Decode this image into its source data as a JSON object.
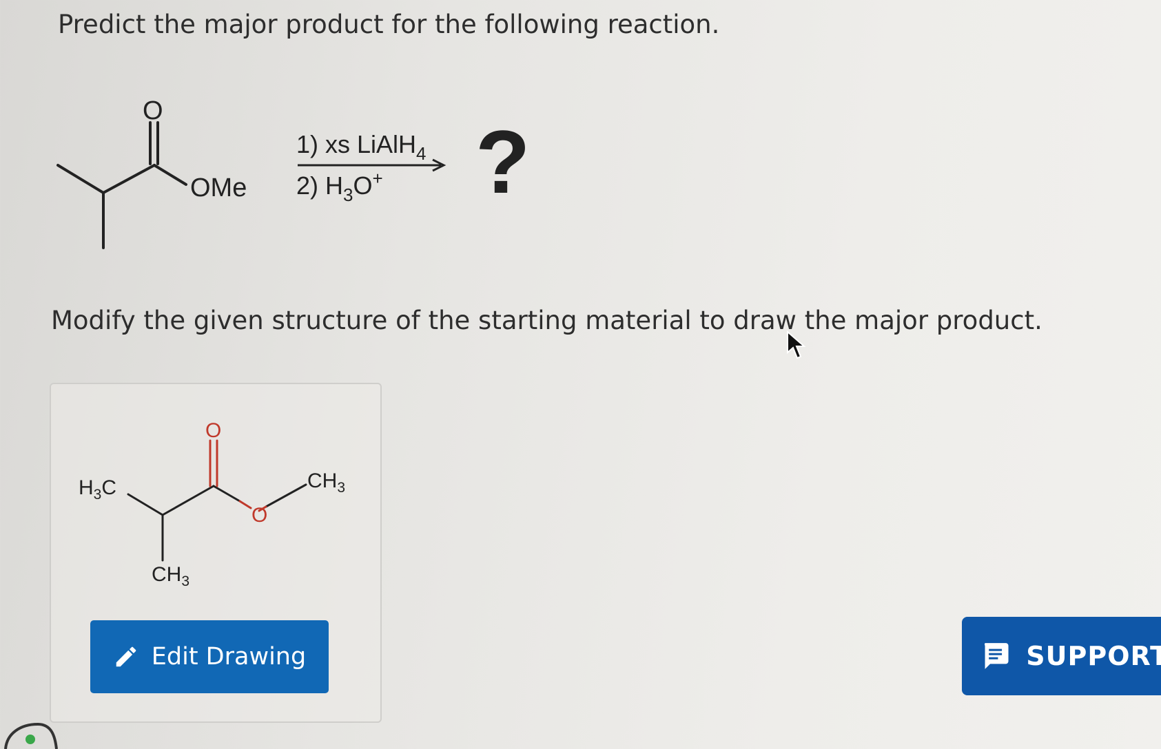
{
  "question": {
    "prompt": "Predict the major product for the following reaction.",
    "instruction": "Modify the given structure of the starting material to draw the major product."
  },
  "reaction": {
    "reactant_carbonyl_O": "O",
    "reactant_ome": "OMe",
    "step1": "1) xs LiAlH",
    "step1_sub": "4",
    "step2_prefix": "2) H",
    "step2_sub": "3",
    "step2_mid": "O",
    "step2_sup": "+",
    "product_placeholder": "?"
  },
  "drawing": {
    "h3c_left_main": "H",
    "h3c_left_sub": "3",
    "h3c_left_tail": "C",
    "carbonyl_O": "O",
    "ester_O": "O",
    "ch3_right_main": "CH",
    "ch3_right_sub": "3",
    "ch3_bottom_main": "CH",
    "ch3_bottom_sub": "3",
    "edit_button_label": "Edit Drawing"
  },
  "support": {
    "label": "SUPPORT"
  },
  "colors": {
    "button_blue": "#1168b5",
    "support_blue": "#0f57a8",
    "oxygen_red": "#c0392b"
  }
}
